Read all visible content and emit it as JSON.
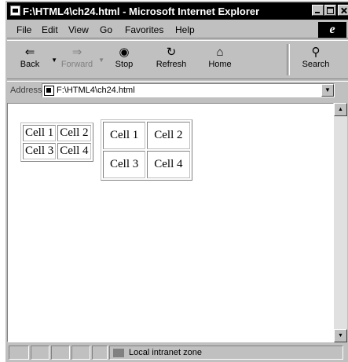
{
  "window": {
    "title": "F:\\HTML4\\ch24.html - Microsoft Internet Explorer"
  },
  "menu": {
    "file": "File",
    "edit": "Edit",
    "view": "View",
    "go": "Go",
    "favorites": "Favorites",
    "help": "Help"
  },
  "toolbar": {
    "back": "Back",
    "forward": "Forward",
    "stop": "Stop",
    "refresh": "Refresh",
    "home": "Home",
    "search": "Search"
  },
  "address": {
    "label": "Address",
    "value": "F:\\HTML4\\ch24.html"
  },
  "tables": {
    "small": [
      [
        "Cell 1",
        "Cell 2"
      ],
      [
        "Cell 3",
        "Cell 4"
      ]
    ],
    "large": [
      [
        "Cell 1",
        "Cell 2"
      ],
      [
        "Cell 3",
        "Cell 4"
      ]
    ]
  },
  "status": {
    "zone": "Local intranet zone"
  }
}
